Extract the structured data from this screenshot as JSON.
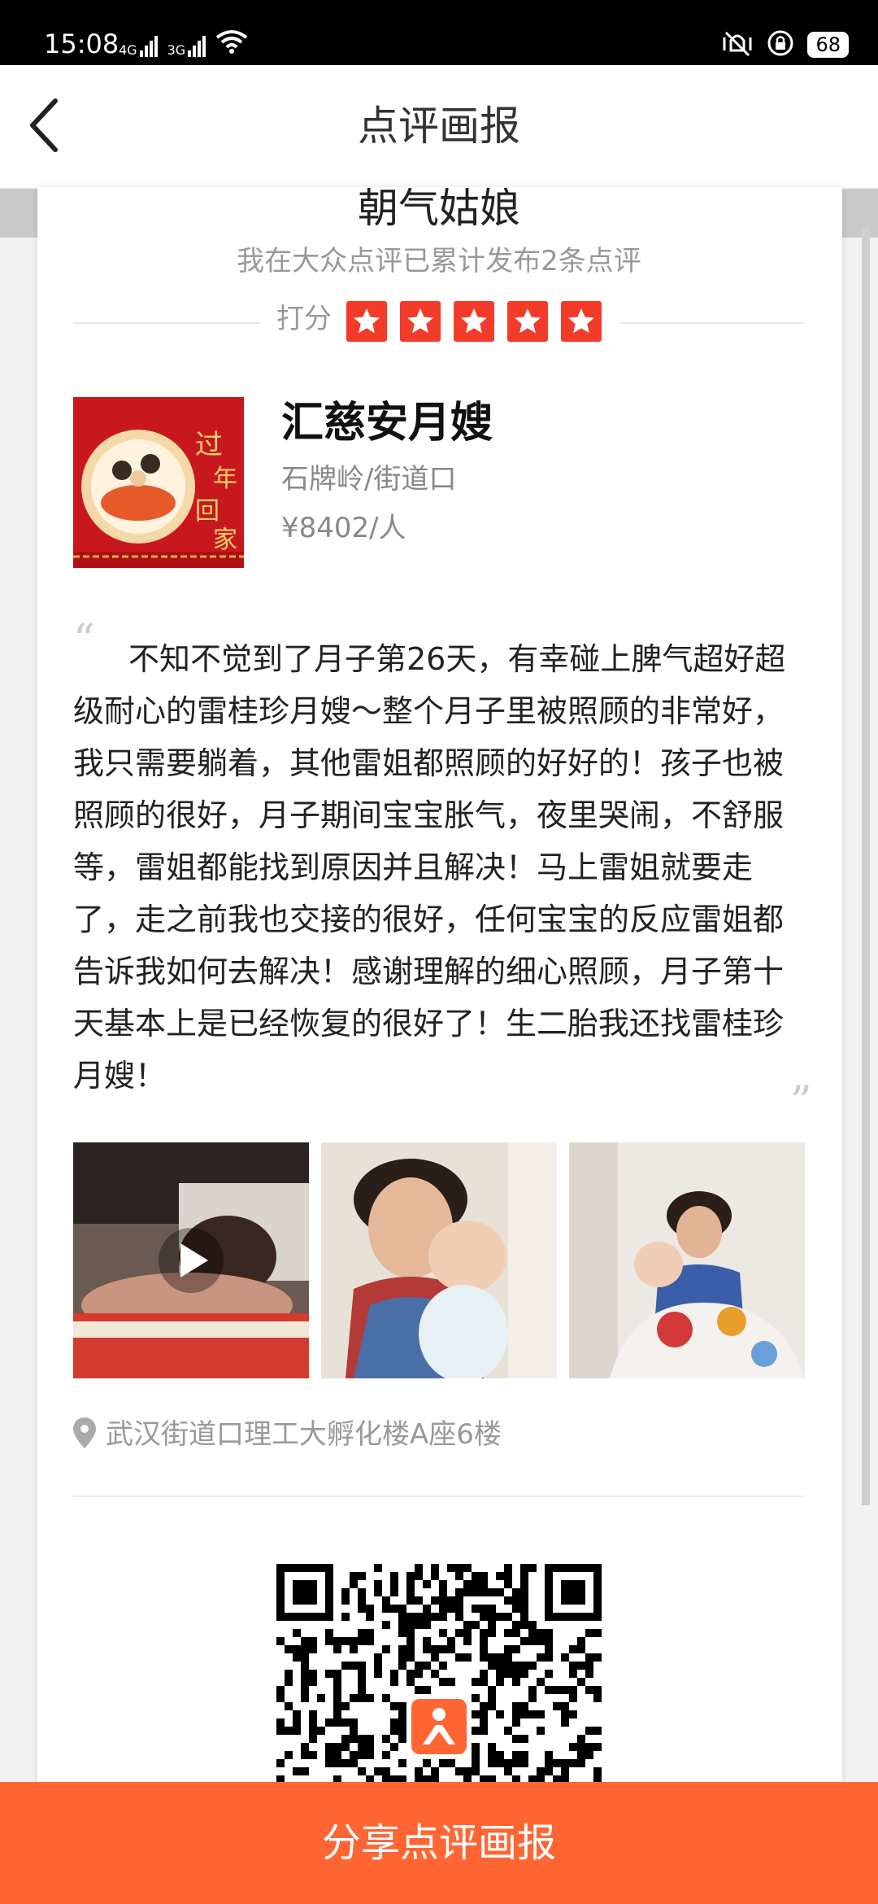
{
  "status_bar": {
    "time": "15:08",
    "network_1": "4G",
    "network_2": "3G",
    "battery": "68"
  },
  "nav": {
    "title": "点评画报",
    "back_icon": "chevron-left-icon"
  },
  "author": {
    "name": "朝气姑娘",
    "subtitle": "我在大众点评已累计发布2条点评"
  },
  "rating": {
    "label": "打分",
    "stars": 5,
    "max": 5,
    "color": "#f33b2b"
  },
  "shop": {
    "name": "汇慈安月嫂",
    "location": "石牌岭/街道口",
    "price": "¥8402/人"
  },
  "review": {
    "text": "不知不觉到了月子第26天，有幸碰上脾气超好超级耐心的雷桂珍月嫂～整个月子里被照顾的非常好，我只需要躺着，其他雷姐都照顾的好好的！孩子也被照顾的很好，月子期间宝宝胀气，夜里哭闹，不舒服等，雷姐都能找到原因并且解决！马上雷姐就要走了，走之前我也交接的很好，任何宝宝的反应雷姐都告诉我如何去解决！感谢理解的细心照顾，月子第十天基本上是已经恢复的很好了！生二胎我还找雷桂珍月嫂！"
  },
  "photos": [
    {
      "type": "video"
    },
    {
      "type": "image"
    },
    {
      "type": "image"
    }
  ],
  "address": {
    "text": "武汉街道口理工大孵化楼A座6楼",
    "icon": "location-pin-icon"
  },
  "share_button": {
    "label": "分享点评画报",
    "color": "#ff6633"
  }
}
